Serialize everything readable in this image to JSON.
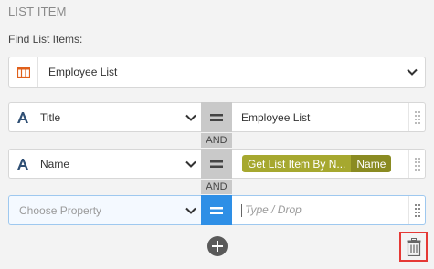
{
  "section_title": "LIST ITEM",
  "find_label": "Find List Items:",
  "list_select": {
    "value": "Employee List",
    "icon": "list-table-icon"
  },
  "conditions": [
    {
      "property": "Title",
      "operator": "=",
      "value": "Employee List",
      "property_icon": "text-a-icon"
    },
    {
      "property": "Name",
      "operator": "=",
      "token_main": "Get List Item By N...",
      "token_field": "Name",
      "property_icon": "text-a-icon"
    },
    {
      "property_placeholder": "Choose Property",
      "operator": "=",
      "value_placeholder": "Type / Drop"
    }
  ],
  "connectors": [
    "AND",
    "AND"
  ],
  "colors": {
    "accent_blue": "#2e8fe6",
    "token_primary": "#a6a82f",
    "token_secondary": "#8a8b22",
    "list_icon": "#e0601b",
    "delete_highlight": "#e53935",
    "property_icon": "#2f4f74"
  }
}
